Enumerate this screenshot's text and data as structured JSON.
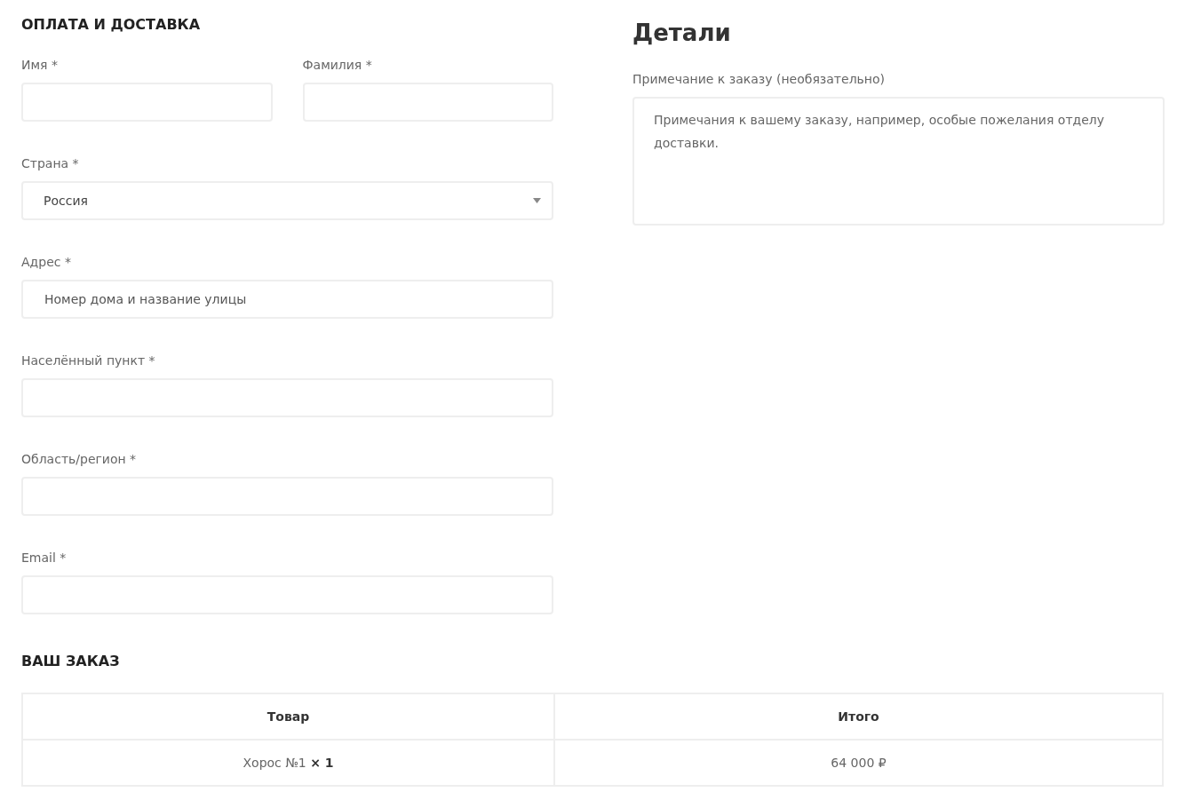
{
  "billing": {
    "title": "ОПЛАТА И ДОСТАВКА",
    "rows": [
      [
        {
          "kind": "text",
          "label": "Имя *"
        },
        {
          "kind": "text",
          "label": "Фамилия *"
        }
      ],
      [
        {
          "kind": "select",
          "label": "Страна *",
          "value": "Россия"
        }
      ],
      [
        {
          "kind": "text",
          "label": "Адрес *",
          "placeholder": "Номер дома и название улицы"
        }
      ],
      [
        {
          "kind": "text",
          "label": "Населённый пункт *"
        }
      ],
      [
        {
          "kind": "text",
          "label": "Область/регион *"
        }
      ],
      [
        {
          "kind": "text",
          "label": "Email *"
        }
      ]
    ]
  },
  "details": {
    "title": "Детали",
    "note_label": "Примечание к заказу (необязательно)",
    "note_placeholder": "Примечания к вашему заказу, например, особые пожелания отделу доставки."
  },
  "order": {
    "title": "ВАШ ЗАКАЗ",
    "columns": [
      "Товар",
      "Итого"
    ],
    "rows": [
      [
        "Хорос №1  **× 1**",
        "64 000 ₽"
      ]
    ]
  }
}
